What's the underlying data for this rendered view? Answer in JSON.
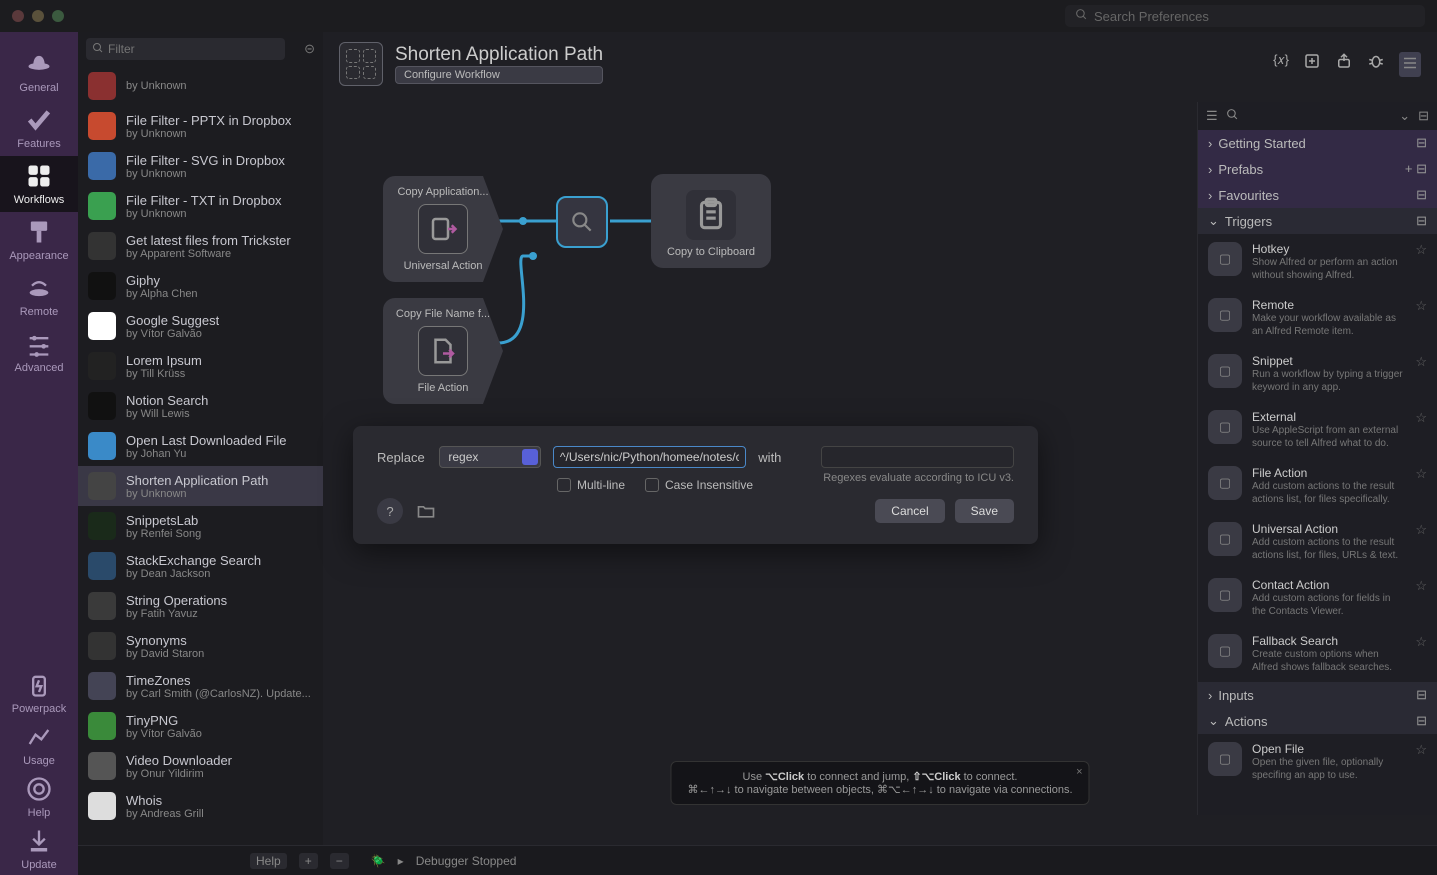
{
  "search_placeholder": "Search Preferences",
  "rail": [
    {
      "label": "General"
    },
    {
      "label": "Features"
    },
    {
      "label": "Workflows"
    },
    {
      "label": "Appearance"
    },
    {
      "label": "Remote"
    },
    {
      "label": "Advanced"
    }
  ],
  "rail_bottom": [
    {
      "label": "Powerpack"
    },
    {
      "label": "Usage"
    },
    {
      "label": "Help"
    },
    {
      "label": "Update"
    }
  ],
  "filter_placeholder": "Filter",
  "wf_items": [
    {
      "name": "",
      "auth": "by Unknown",
      "color": "#8a3030"
    },
    {
      "name": "File Filter - PPTX in Dropbox",
      "auth": "by Unknown",
      "color": "#c74a2f"
    },
    {
      "name": "File Filter - SVG in Dropbox",
      "auth": "by Unknown",
      "color": "#3a6aa8"
    },
    {
      "name": "File Filter - TXT in Dropbox",
      "auth": "by Unknown",
      "color": "#3aa050"
    },
    {
      "name": "Get latest files from Trickster",
      "auth": "by Apparent Software",
      "color": "#333"
    },
    {
      "name": "Giphy",
      "auth": "by Alpha Chen",
      "color": "#111"
    },
    {
      "name": "Google Suggest",
      "auth": "by Vítor Galvão",
      "color": "#fff"
    },
    {
      "name": "Lorem Ipsum",
      "auth": "by Till Krüss",
      "color": "#222"
    },
    {
      "name": "Notion Search",
      "auth": "by Will Lewis",
      "color": "#111"
    },
    {
      "name": "Open Last Downloaded File",
      "auth": "by Johan Yu",
      "color": "#3a8ac8"
    },
    {
      "name": "Shorten Application Path",
      "auth": "by Unknown",
      "color": "#444",
      "sel": true
    },
    {
      "name": "SnippetsLab",
      "auth": "by Renfei Song",
      "color": "#1a2a1a"
    },
    {
      "name": "StackExchange Search",
      "auth": "by Dean Jackson",
      "color": "#2a4a6a"
    },
    {
      "name": "String Operations",
      "auth": "by Fatih Yavuz",
      "color": "#3a3a3a"
    },
    {
      "name": "Synonyms",
      "auth": "by David Staron",
      "color": "#333"
    },
    {
      "name": "TimeZones",
      "auth": "by Carl Smith (@CarlosNZ). Update...",
      "color": "#445"
    },
    {
      "name": "TinyPNG",
      "auth": "by Vítor Galvão",
      "color": "#3a8a3a"
    },
    {
      "name": "Video Downloader",
      "auth": "by Onur Yildirim",
      "color": "#555"
    },
    {
      "name": "Whois",
      "auth": "by Andreas Grill",
      "color": "#ddd"
    }
  ],
  "main_title": "Shorten Application Path",
  "configure_label": "Configure Workflow",
  "nodes": {
    "copy_app": "Copy Application...",
    "universal": "Universal Action",
    "copy_file": "Copy File Name f...",
    "file_action": "File Action",
    "clipboard": "Copy to Clipboard"
  },
  "modal": {
    "replace_label": "Replace",
    "mode": "regex",
    "pattern": "^/Users/nic/Python/homee/notes/cc",
    "with_label": "with",
    "with_value": "",
    "multiline": "Multi-line",
    "case": "Case Insensitive",
    "note": "Regexes evaluate according to ICU v3.",
    "cancel": "Cancel",
    "save": "Save"
  },
  "palette": {
    "sections": [
      {
        "label": "Getting Started"
      },
      {
        "label": "Prefabs"
      },
      {
        "label": "Favourites"
      }
    ],
    "triggers_label": "Triggers",
    "triggers": [
      {
        "t": "Hotkey",
        "d": "Show Alfred or perform an action without showing Alfred."
      },
      {
        "t": "Remote",
        "d": "Make your workflow available as an Alfred Remote item."
      },
      {
        "t": "Snippet",
        "d": "Run a workflow by typing a trigger keyword in any app."
      },
      {
        "t": "External",
        "d": "Use AppleScript from an external source to tell Alfred what to do."
      },
      {
        "t": "File Action",
        "d": "Add custom actions to the result actions list, for files specifically."
      },
      {
        "t": "Universal Action",
        "d": "Add custom actions to the result actions list, for files, URLs & text."
      },
      {
        "t": "Contact Action",
        "d": "Add custom actions for fields in the Contacts Viewer."
      },
      {
        "t": "Fallback Search",
        "d": "Create custom options when Alfred shows fallback searches."
      }
    ],
    "inputs_label": "Inputs",
    "actions_label": "Actions",
    "actions": [
      {
        "t": "Open File",
        "d": "Open the given file, optionally specifing an app to use."
      }
    ]
  },
  "status": {
    "help": "Help",
    "debugger": "Debugger Stopped"
  },
  "tip": {
    "l1a": "Use ",
    "l1b": "⌥Click",
    "l1c": " to connect and jump, ",
    "l1d": "⇧⌥Click",
    "l1e": " to connect.",
    "l2a": "⌘←↑→↓ to navigate between objects, ",
    "l2b": "⌘⌥←↑→↓ to navigate via connections."
  }
}
